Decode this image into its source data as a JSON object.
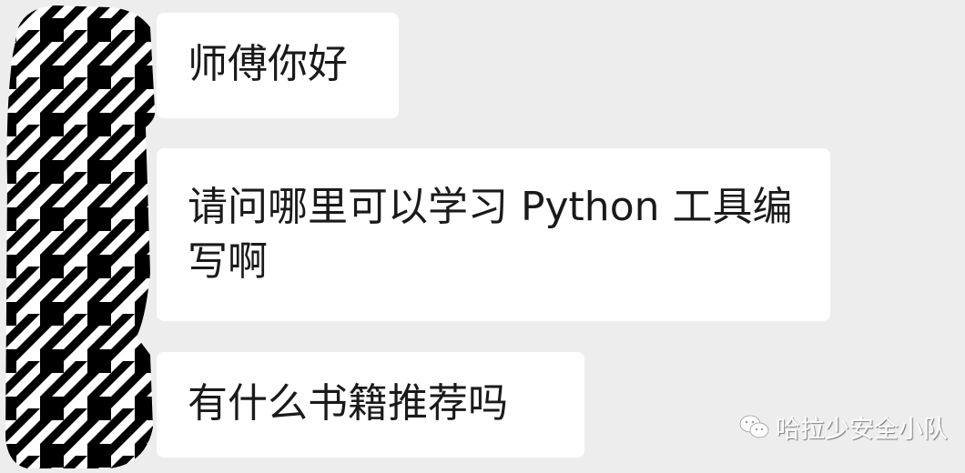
{
  "messages": [
    {
      "text": "师傅你好"
    },
    {
      "text": "请问哪里可以学习 Python 工具编写啊"
    },
    {
      "text": "有什么书籍推荐吗"
    }
  ],
  "avatar": {
    "style": "houndstooth-mask",
    "colors": [
      "#000000",
      "#ffffff"
    ]
  },
  "watermark": {
    "icon": "wechat-icon",
    "text": "哈拉少安全小队"
  },
  "colors": {
    "background": "#ededed",
    "bubble": "#ffffff",
    "text": "#1a1a1a"
  }
}
